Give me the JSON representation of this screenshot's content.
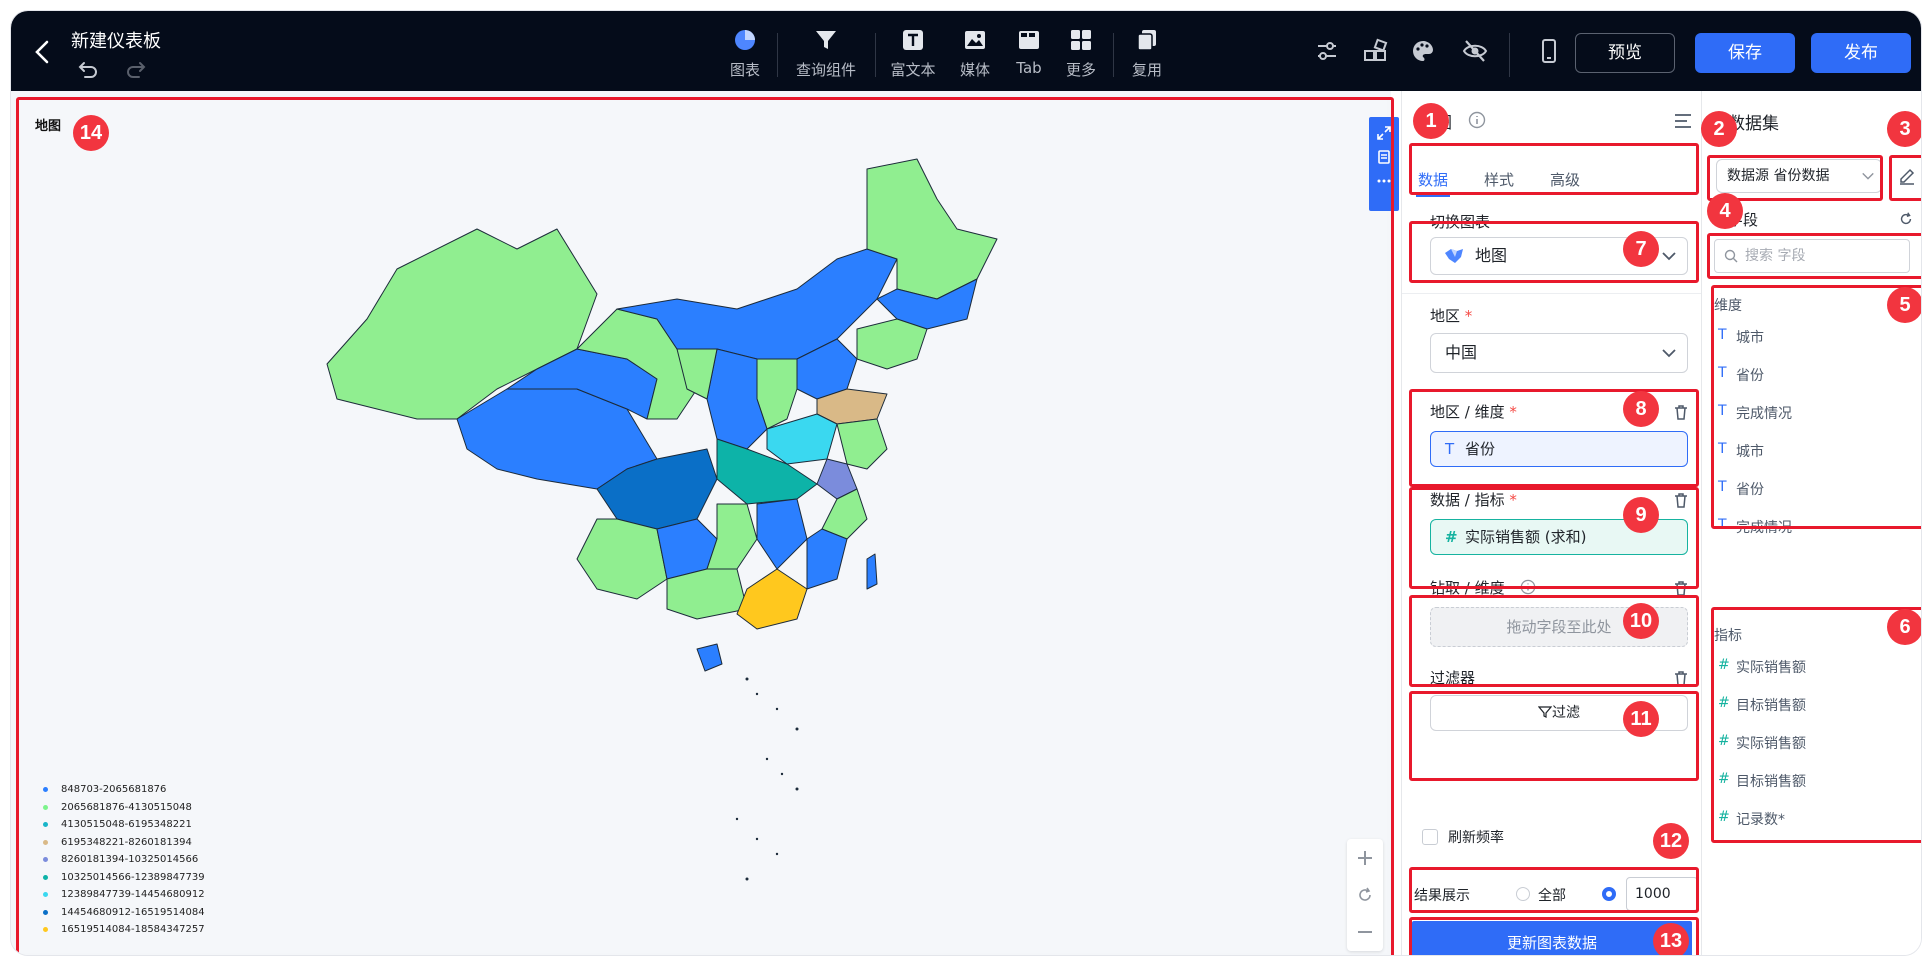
{
  "header": {
    "title": "新建仪表板",
    "tools": [
      {
        "label": "图表",
        "icon": "chart-pie-icon"
      },
      {
        "label": "查询组件",
        "icon": "funnel-icon"
      },
      {
        "label": "富文本",
        "icon": "text-box-icon"
      },
      {
        "label": "媒体",
        "icon": "image-icon"
      },
      {
        "label": "Tab",
        "icon": "tab-icon"
      },
      {
        "label": "更多",
        "icon": "grid-icon"
      },
      {
        "label": "复用",
        "icon": "copy-icon"
      }
    ],
    "preview_label": "预览",
    "save_label": "保存",
    "publish_label": "发布",
    "accent_color": "#2f6cf7",
    "bg_color": "#050c1a"
  },
  "map_card": {
    "title": "地图",
    "legend": [
      {
        "label": "848703-2065681876",
        "color": "#2b7fff"
      },
      {
        "label": "2065681876-4130515048",
        "color": "#7cf38b"
      },
      {
        "label": "4130515048-6195348221",
        "color": "#19b5c9"
      },
      {
        "label": "6195348221-8260181394",
        "color": "#d9b987"
      },
      {
        "label": "8260181394-10325014566",
        "color": "#7b8cdc"
      },
      {
        "label": "10325014566-12389847739",
        "color": "#0db3a8"
      },
      {
        "label": "12389847739-14454680912",
        "color": "#3ad8f0"
      },
      {
        "label": "14454680912-16519514084",
        "color": "#0a6fc7"
      },
      {
        "label": "16519514084-18584347257",
        "color": "#ffc81e"
      }
    ]
  },
  "props": {
    "title": "地图",
    "tabs": [
      {
        "label": "数据",
        "active": true
      },
      {
        "label": "样式",
        "active": false
      },
      {
        "label": "高级",
        "active": false
      }
    ],
    "switch_chart_label": "切换图表",
    "chart_type": "地图",
    "region_label": "地区",
    "region_value": "中国",
    "region_dim_label": "地区 / 维度",
    "region_dim_value": "省份",
    "metric_label": "数据 / 指标",
    "metric_value": "实际销售额 (求和)",
    "drill_label": "钻取 / 维度",
    "drill_placeholder": "拖动字段至此处",
    "filter_label": "过滤器",
    "filter_button": "过滤",
    "refresh_label": "刷新频率",
    "result_label": "结果展示",
    "result_all": "全部",
    "result_count": "1000",
    "update_button": "更新图表数据"
  },
  "dataset": {
    "title": "数据集",
    "source_label": "数据源 省份数据",
    "fields_label": "字段",
    "search_placeholder": "搜索 字段",
    "dimension_label": "维度",
    "dimensions": [
      "城市",
      "省份",
      "完成情况",
      "城市",
      "省份",
      "完成情况"
    ],
    "metric_label": "指标",
    "metrics": [
      "实际销售额",
      "目标销售额",
      "实际销售额",
      "目标销售额",
      "记录数*"
    ]
  },
  "annotations": [
    "1",
    "2",
    "3",
    "4",
    "5",
    "6",
    "7",
    "8",
    "9",
    "10",
    "11",
    "12",
    "13",
    "14"
  ]
}
